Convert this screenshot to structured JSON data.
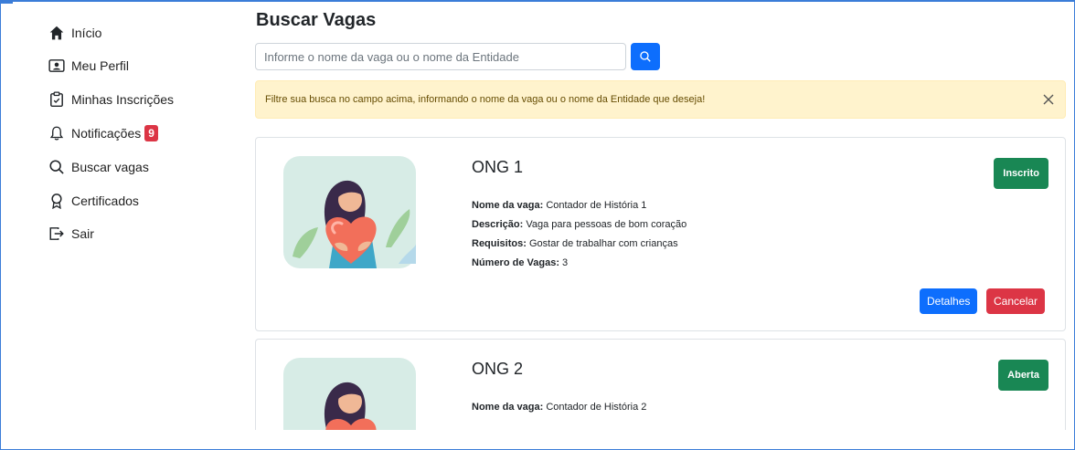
{
  "sidebar": {
    "items": [
      {
        "label": "Início",
        "icon": "home-icon"
      },
      {
        "label": "Meu Perfil",
        "icon": "profile-card-icon"
      },
      {
        "label": "Minhas Inscrições",
        "icon": "clipboard-icon"
      },
      {
        "label": "Notificações",
        "icon": "bell-icon",
        "badge": "9"
      },
      {
        "label": "Buscar vagas",
        "icon": "search-icon"
      },
      {
        "label": "Certificados",
        "icon": "award-icon"
      },
      {
        "label": "Sair",
        "icon": "logout-icon"
      }
    ]
  },
  "main": {
    "title": "Buscar Vagas",
    "search": {
      "placeholder": "Informe o nome da vaga ou o nome da Entidade",
      "value": ""
    },
    "alert": {
      "text": "Filtre sua busca no campo acima, informando o nome da vaga ou o nome da Entidade que deseja!"
    },
    "labels": {
      "nome_vaga": "Nome da vaga:",
      "descricao": "Descrição:",
      "requisitos": "Requisitos:",
      "numero_vagas": "Número de Vagas:"
    },
    "cards": [
      {
        "org": "ONG 1",
        "status": "Inscrito",
        "nome_vaga": "Contador de História 1",
        "descricao": "Vaga para pessoas de bom coração",
        "requisitos": "Gostar de trabalhar com crianças",
        "numero_vagas": "3",
        "details_label": "Detalhes",
        "cancel_label": "Cancelar"
      },
      {
        "org": "ONG 2",
        "status": "Aberta",
        "nome_vaga": "Contador de História 2"
      }
    ]
  },
  "colors": {
    "primary": "#0d6efd",
    "danger": "#dc3545",
    "success": "#198754",
    "warning_bg": "#fff3cd",
    "warning_text": "#664d03"
  }
}
